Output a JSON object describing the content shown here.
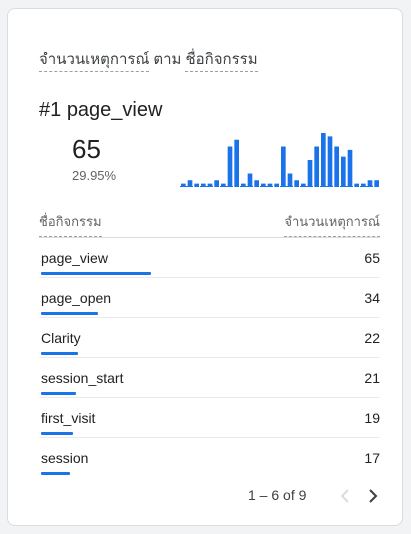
{
  "card": {
    "title_metric": "จำนวนเหตุการณ์",
    "title_connector": "ตาม",
    "title_dimension": "ชื่อกิจกรรม",
    "top_rank": "#1",
    "top_name": "page_view",
    "top_value": "65",
    "top_percent": "29.95%"
  },
  "chart_data": {
    "type": "bar",
    "values": [
      1,
      2,
      1,
      1,
      1,
      2,
      1,
      12,
      14,
      1,
      4,
      2,
      1,
      1,
      1,
      12,
      4,
      2,
      1,
      8,
      12,
      16,
      15,
      12,
      9,
      11,
      1,
      1,
      2,
      2
    ],
    "color": "#1a73e8"
  },
  "table": {
    "col_name": "ชื่อกิจกรรม",
    "col_value": "จำนวนเหตุการณ์",
    "rows": [
      {
        "name": "page_view",
        "value": "65",
        "share": 1.0
      },
      {
        "name": "page_open",
        "value": "34",
        "share": 0.52
      },
      {
        "name": "Clarity",
        "value": "22",
        "share": 0.34
      },
      {
        "name": "session_start",
        "value": "21",
        "share": 0.32
      },
      {
        "name": "first_visit",
        "value": "19",
        "share": 0.29
      },
      {
        "name": "session",
        "value": "17",
        "share": 0.26
      }
    ]
  },
  "pagination": {
    "range": "1 – 6 of 9"
  },
  "colors": {
    "accent": "#1a73e8",
    "border": "#dadce0"
  }
}
